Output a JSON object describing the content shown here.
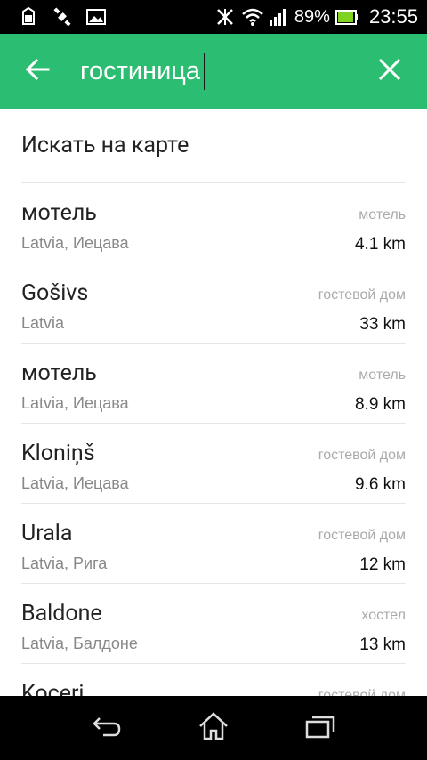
{
  "theme": {
    "accent": "#2bbd72"
  },
  "status_bar": {
    "battery_percent": "89%",
    "time": "23:55",
    "icons": [
      "sim-card-icon",
      "satellite-icon",
      "image-icon",
      "nfc-off-icon",
      "wifi-icon",
      "signal-icon",
      "battery-icon"
    ]
  },
  "search": {
    "query": "гостиница",
    "back_icon": "arrow-left-icon",
    "clear_icon": "close-icon"
  },
  "map_search_label": "Искать на карте",
  "results": [
    {
      "name": "мотель",
      "location": "Latvia, Иецава",
      "type": "мотель",
      "distance": "4.1 km"
    },
    {
      "name": "Gošivs",
      "location": "Latvia",
      "type": "гостевой дом",
      "distance": "33 km"
    },
    {
      "name": "мотель",
      "location": "Latvia, Иецава",
      "type": "мотель",
      "distance": "8.9 km"
    },
    {
      "name": "Kloniņš",
      "location": "Latvia, Иецава",
      "type": "гостевой дом",
      "distance": "9.6 km"
    },
    {
      "name": "Urala",
      "location": "Latvia, Рига",
      "type": "гостевой дом",
      "distance": "12 km"
    },
    {
      "name": "Baldone",
      "location": "Latvia, Балдоне",
      "type": "хостел",
      "distance": "13 km"
    },
    {
      "name": "Koceri",
      "location": "",
      "type": "гостевой дом",
      "distance": ""
    }
  ],
  "nav_bar": {
    "buttons": [
      "back-icon",
      "home-icon",
      "recent-apps-icon"
    ]
  }
}
